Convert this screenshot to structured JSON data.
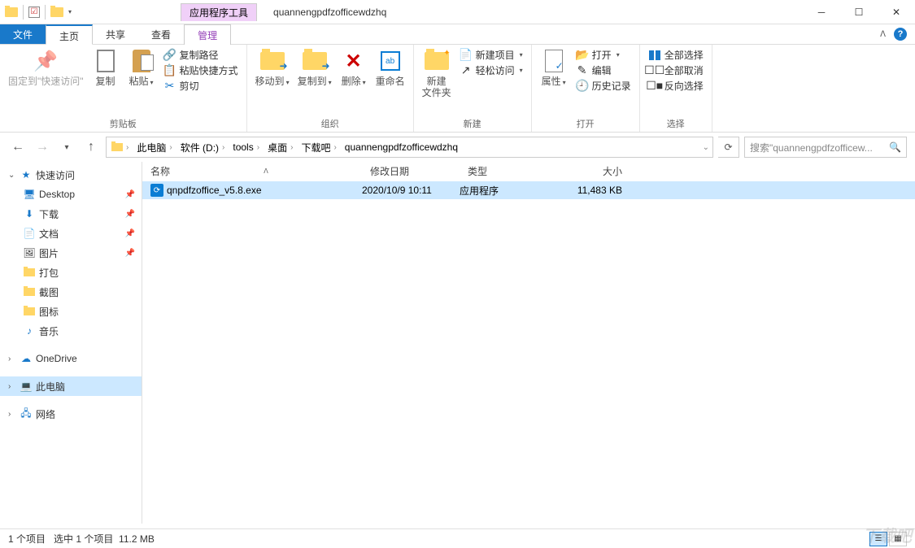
{
  "titlebar": {
    "context_tab": "应用程序工具",
    "title": "quannengpdfzofficewdzhq"
  },
  "tabs": {
    "file": "文件",
    "home": "主页",
    "share": "共享",
    "view": "查看",
    "manage": "管理"
  },
  "ribbon": {
    "clipboard": {
      "pin": "固定到\"快速访问\"",
      "copy": "复制",
      "paste": "粘贴",
      "copy_path": "复制路径",
      "paste_shortcut": "粘贴快捷方式",
      "cut": "剪切",
      "label": "剪贴板"
    },
    "organize": {
      "move_to": "移动到",
      "copy_to": "复制到",
      "delete": "删除",
      "rename": "重命名",
      "label": "组织"
    },
    "new": {
      "new_folder": "新建\n文件夹",
      "new_item": "新建项目",
      "easy_access": "轻松访问",
      "label": "新建"
    },
    "open": {
      "properties": "属性",
      "open": "打开",
      "edit": "编辑",
      "history": "历史记录",
      "label": "打开"
    },
    "select": {
      "select_all": "全部选择",
      "select_none": "全部取消",
      "invert": "反向选择",
      "label": "选择"
    }
  },
  "breadcrumb": {
    "items": [
      "此电脑",
      "软件 (D:)",
      "tools",
      "桌面",
      "下载吧",
      "quannengpdfzofficewdzhq"
    ]
  },
  "search_placeholder": "搜索\"quannengpdfzofficew...",
  "sidebar": {
    "quick_access": "快速访问",
    "desktop": "Desktop",
    "downloads": "下载",
    "documents": "文档",
    "pictures": "图片",
    "f1": "打包",
    "f2": "截图",
    "f3": "图标",
    "f4": "音乐",
    "onedrive": "OneDrive",
    "this_pc": "此电脑",
    "network": "网络"
  },
  "columns": {
    "name": "名称",
    "date": "修改日期",
    "type": "类型",
    "size": "大小"
  },
  "files": [
    {
      "name": "qnpdfzoffice_v5.8.exe",
      "date": "2020/10/9 10:11",
      "type": "应用程序",
      "size": "11,483 KB"
    }
  ],
  "status": {
    "items": "1 个项目",
    "selected": "选中 1 个项目",
    "size": "11.2 MB"
  }
}
